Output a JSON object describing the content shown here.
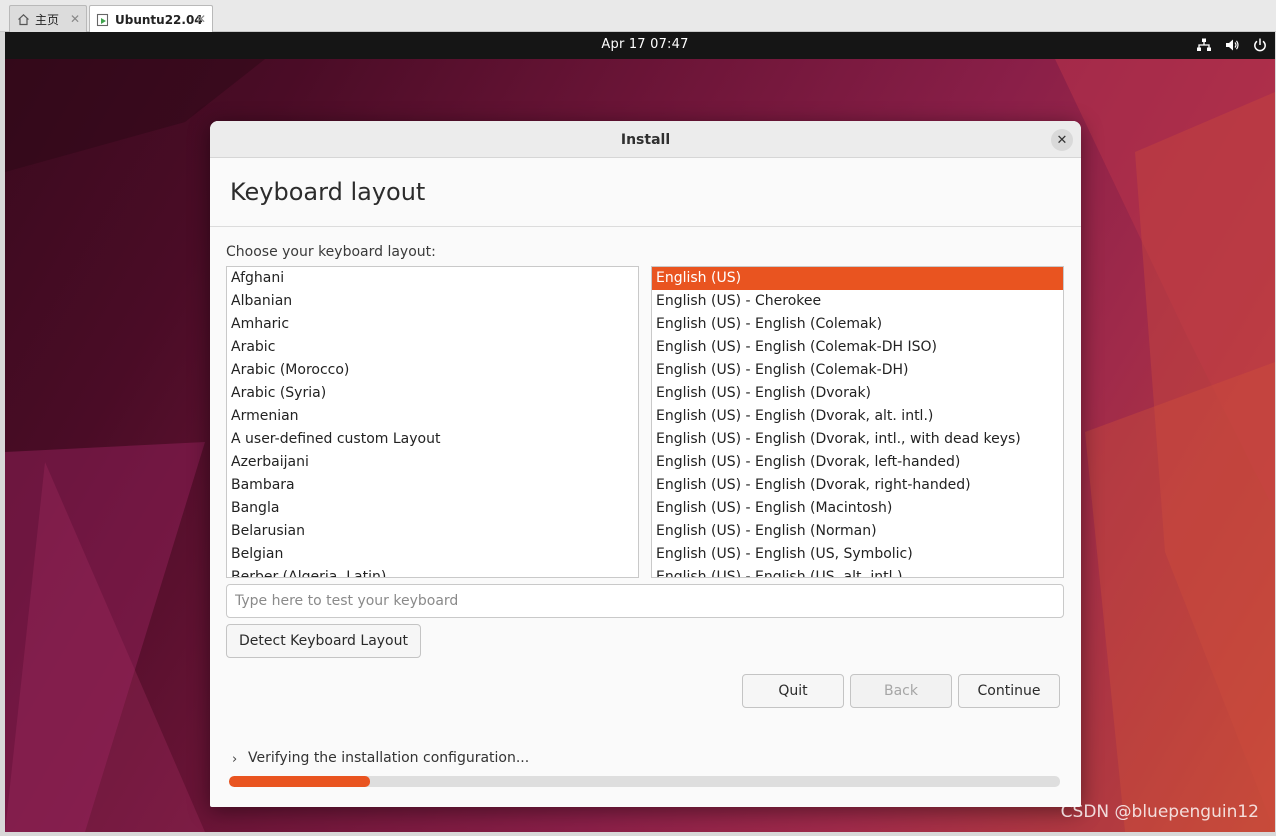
{
  "tabs": [
    {
      "label": "主页",
      "icon": "home-icon",
      "active": false
    },
    {
      "label": "Ubuntu22.04",
      "icon": "vm-icon",
      "active": true
    }
  ],
  "topbar": {
    "clock": "Apr 17  07:47",
    "tray_icons": [
      "network-icon",
      "volume-icon",
      "power-icon"
    ]
  },
  "dialog": {
    "title": "Install",
    "heading": "Keyboard layout",
    "choose_label": "Choose your keyboard layout:",
    "layouts": [
      "Afghani",
      "Albanian",
      "Amharic",
      "Arabic",
      "Arabic (Morocco)",
      "Arabic (Syria)",
      "Armenian",
      "A user-defined custom Layout",
      "Azerbaijani",
      "Bambara",
      "Bangla",
      "Belarusian",
      "Belgian",
      "Berber (Algeria, Latin)"
    ],
    "variants": [
      "English (US)",
      "English (US) - Cherokee",
      "English (US) - English (Colemak)",
      "English (US) - English (Colemak-DH ISO)",
      "English (US) - English (Colemak-DH)",
      "English (US) - English (Dvorak)",
      "English (US) - English (Dvorak, alt. intl.)",
      "English (US) - English (Dvorak, intl., with dead keys)",
      "English (US) - English (Dvorak, left-handed)",
      "English (US) - English (Dvorak, right-handed)",
      "English (US) - English (Macintosh)",
      "English (US) - English (Norman)",
      "English (US) - English (US, Symbolic)",
      "English (US) - English (US, alt. intl.)"
    ],
    "selected_variant": "English (US)",
    "test_placeholder": "Type here to test your keyboard",
    "test_value": "",
    "detect_label": "Detect Keyboard Layout",
    "quit_label": "Quit",
    "back_label": "Back",
    "continue_label": "Continue",
    "status_text": "Verifying the installation configuration...",
    "progress_percent": 17
  },
  "watermark": "CSDN @bluepenguin12",
  "colors": {
    "accent": "#e95420",
    "topbar": "#151515"
  }
}
